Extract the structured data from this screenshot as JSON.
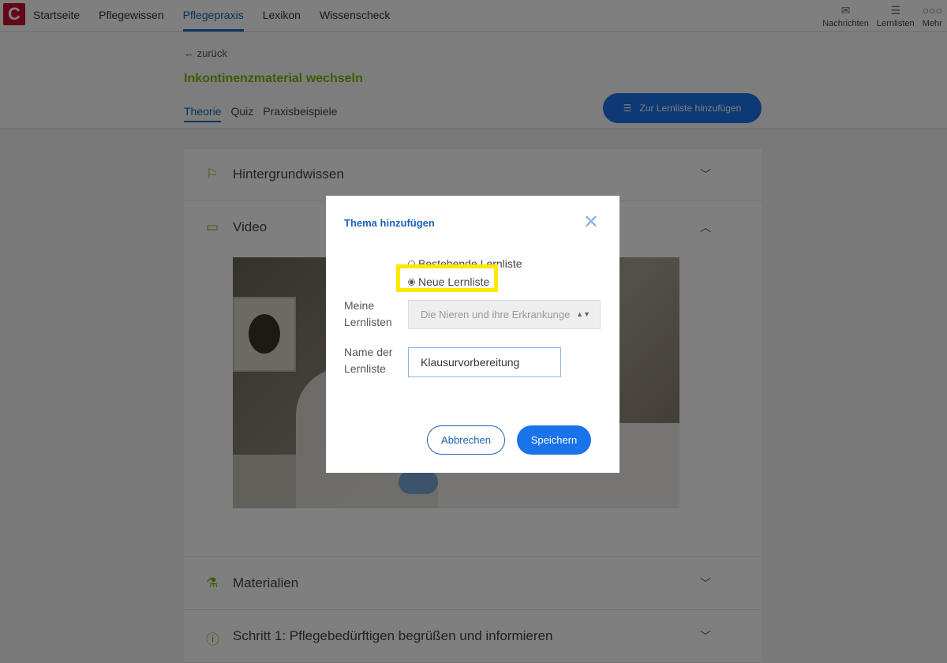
{
  "nav": {
    "logo": "C",
    "items": [
      {
        "label": "Startseite",
        "active": false
      },
      {
        "label": "Pflegewissen",
        "active": false
      },
      {
        "label": "Pflegepraxis",
        "active": true
      },
      {
        "label": "Lexikon",
        "active": false
      },
      {
        "label": "Wissenscheck",
        "active": false
      }
    ],
    "right": [
      {
        "label": "Nachrichten",
        "icon": "mail-icon",
        "glyph": "✉"
      },
      {
        "label": "Lernlisten",
        "icon": "list-icon",
        "glyph": "☰"
      },
      {
        "label": "Mehr",
        "icon": "more-icon",
        "glyph": "○○○"
      }
    ]
  },
  "page": {
    "back_label": "zurück",
    "title": "Inkontinenzmaterial wechseln",
    "tabs": [
      {
        "label": "Theorie",
        "active": true
      },
      {
        "label": "Quiz",
        "active": false
      },
      {
        "label": "Praxisbeispiele",
        "active": false
      }
    ],
    "add_to_list_label": "Zur Lernliste hinzufügen"
  },
  "sections": [
    {
      "title": "Hintergrundwissen",
      "icon": "flag-icon",
      "glyph": "⚐",
      "expanded": false
    },
    {
      "title": "Video",
      "icon": "video-icon",
      "glyph": "▭",
      "expanded": true
    },
    {
      "title": "Materialien",
      "icon": "flask-icon",
      "glyph": "⚗",
      "expanded": false
    },
    {
      "title": "Schritt 1: Pflegebedürftigen begrüßen und informieren",
      "icon": "info-icon",
      "glyph": "ⓘ",
      "expanded": false
    }
  ],
  "modal": {
    "title": "Thema hinzufügen",
    "radio_existing": "Bestehende Lernliste",
    "radio_new": "Neue Lernliste",
    "selected": "new",
    "my_lists_label": "Meine Lernlisten",
    "my_lists_value": "Die Nieren und ihre Erkrankunge",
    "name_label": "Name der Lernliste",
    "name_value": "Klausurvorbereitung",
    "cancel_label": "Abbrechen",
    "save_label": "Speichern"
  },
  "colors": {
    "brand_red": "#c8102e",
    "accent_blue": "#1a73e8",
    "title_green": "#7ab800",
    "highlight_yellow": "#ffe800"
  }
}
